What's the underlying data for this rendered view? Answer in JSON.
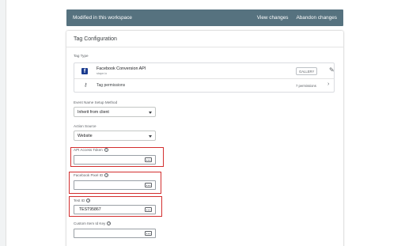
{
  "banner": {
    "title": "Modified in this workspace",
    "view_changes": "View changes",
    "abandon_changes": "Abandon changes",
    "color": "#56727f"
  },
  "card": {
    "title": "Tag Configuration",
    "tag_type_label": "Tag Type",
    "tag": {
      "icon": "facebook-icon",
      "name": "Facebook Conversion API",
      "subtitle": "stape.io",
      "gallery_badge": "GALLERY",
      "permissions_label": "Tag permissions",
      "permissions_count": "7 permissions"
    },
    "event_method": {
      "label": "Event Name Setup Method",
      "value": "Inherit from client"
    },
    "action_source": {
      "label": "Action Source",
      "value": "Website"
    },
    "api_token": {
      "label": "API Access Token",
      "value": ""
    },
    "pixel_id": {
      "label": "Facebook Pixel ID",
      "value": ""
    },
    "test_id": {
      "label": "Test ID",
      "value": "TEST95867"
    },
    "custom_key": {
      "label": "Custom Item Id Key",
      "value": ""
    }
  },
  "highlight_color": "#d32f2f"
}
